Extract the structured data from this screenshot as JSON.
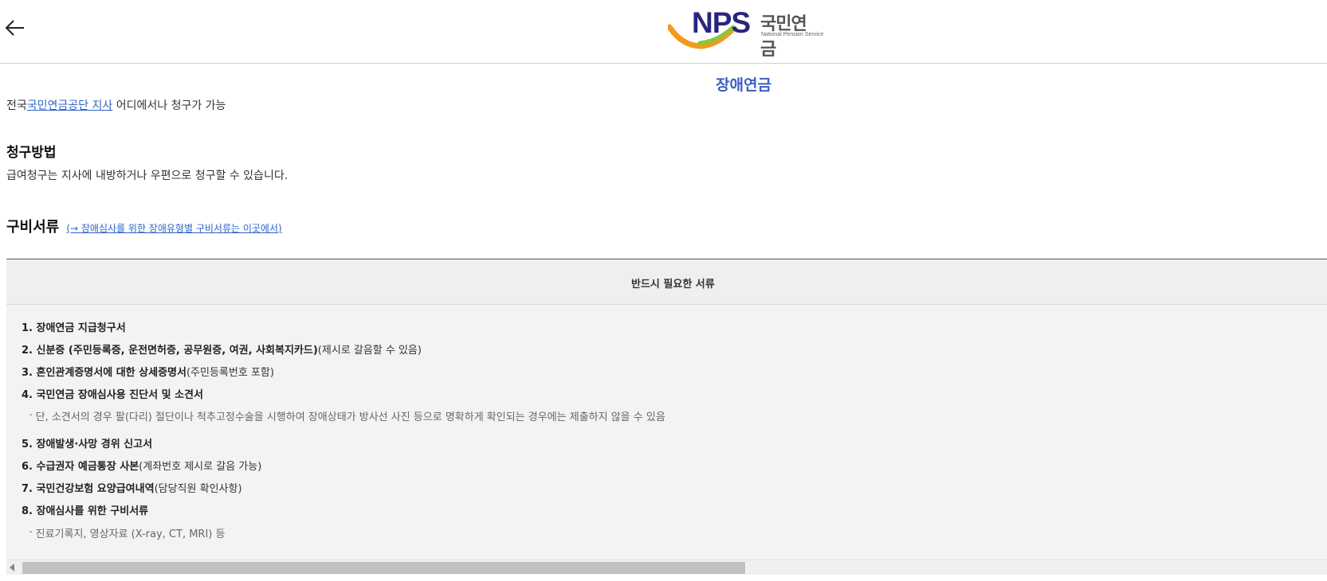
{
  "header": {
    "back_icon": "arrow-left-icon",
    "logo": {
      "brand": "NPS",
      "korean_name": "국민연금",
      "english_name": "National Pension Service",
      "colors": {
        "navy": "#27257f",
        "orange": "#f39a1e",
        "green": "#8cc63f"
      }
    }
  },
  "page": {
    "title": "장애연금",
    "intro_prefix": "전국",
    "intro_link": "국민연금공단 지사",
    "intro_suffix": " 어디에서나 청구가 가능"
  },
  "claim_method": {
    "title": "청구방법",
    "description": "급여청구는 지사에 내방하거나 우편으로 청구할 수 있습니다."
  },
  "documents": {
    "title": "구비서류",
    "link": "(→ 장애심사를 위한 장애유형별 구비서류는 이곳에서)",
    "table_header": "반드시 필요한 서류",
    "items": [
      {
        "bold": "1. 장애연금 지급청구서",
        "rest": ""
      },
      {
        "bold": "2. 신분증 (주민등록증, 운전면허증, 공무원증, 여권, 사회복지카드)",
        "rest": "(제시로 갈음할 수 있음)"
      },
      {
        "bold": "3. 혼인관계증명서에 대한 상세증명서",
        "rest": "(주민등록번호 포함)"
      },
      {
        "bold": "4. 국민연금 장애심사용 진단서 및 소견서",
        "rest": ""
      },
      {
        "note": "단, 소견서의 경우 팔(다리) 절단이나 척추고정수술을 시행하여 장애상태가 방사선 사진 등으로 명확하게 확인되는 경우에는 제출하지 않을 수 있음"
      },
      {
        "bold": "5. 장애발생·사망 경위 신고서",
        "rest": ""
      },
      {
        "bold": "6. 수급권자 예금통장 사본",
        "rest": "(계좌번호 제시로 갈음 가능)"
      },
      {
        "bold": "7. 국민건강보험 요양급여내역",
        "rest": "(담당직원 확인사항)"
      },
      {
        "bold": "8. 장애심사를 위한 구비서류",
        "rest": ""
      },
      {
        "note": "진료기록지, 영상자료 (X-ray, CT, MRI) 등"
      }
    ]
  },
  "colors": {
    "accent": "#3a5ec4",
    "link": "#2f64c8"
  }
}
